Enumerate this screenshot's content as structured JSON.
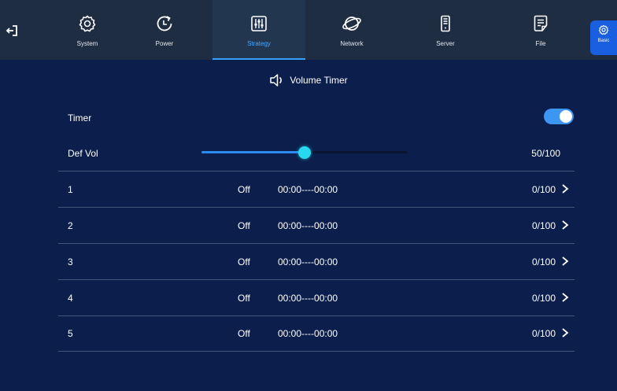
{
  "tabs": [
    {
      "label": "System",
      "icon": "gear-icon"
    },
    {
      "label": "Power",
      "icon": "power-clock-icon"
    },
    {
      "label": "Strategy",
      "icon": "sliders-icon",
      "active": true
    },
    {
      "label": "Network",
      "icon": "network-globe-icon"
    },
    {
      "label": "Server",
      "icon": "server-icon"
    },
    {
      "label": "File",
      "icon": "file-icon"
    }
  ],
  "basic_label": "Basic",
  "page_title": "Volume Timer",
  "timer": {
    "label": "Timer",
    "enabled": true
  },
  "def_vol": {
    "label": "Def Vol",
    "value_text": "50/100",
    "value": 50,
    "max": 100
  },
  "rows": [
    {
      "index": "1",
      "state": "Off",
      "time": "00:00----00:00",
      "volume": "0/100"
    },
    {
      "index": "2",
      "state": "Off",
      "time": "00:00----00:00",
      "volume": "0/100"
    },
    {
      "index": "3",
      "state": "Off",
      "time": "00:00----00:00",
      "volume": "0/100"
    },
    {
      "index": "4",
      "state": "Off",
      "time": "00:00----00:00",
      "volume": "0/100"
    },
    {
      "index": "5",
      "state": "Off",
      "time": "00:00----00:00",
      "volume": "0/100"
    }
  ],
  "colors": {
    "background": "#0c1f4c",
    "topbar": "#1e2d42",
    "accent": "#3aa0ff",
    "toggle": "#3b97f2",
    "slider_thumb": "#28d8ee",
    "basic_button": "#1a5fe0"
  }
}
